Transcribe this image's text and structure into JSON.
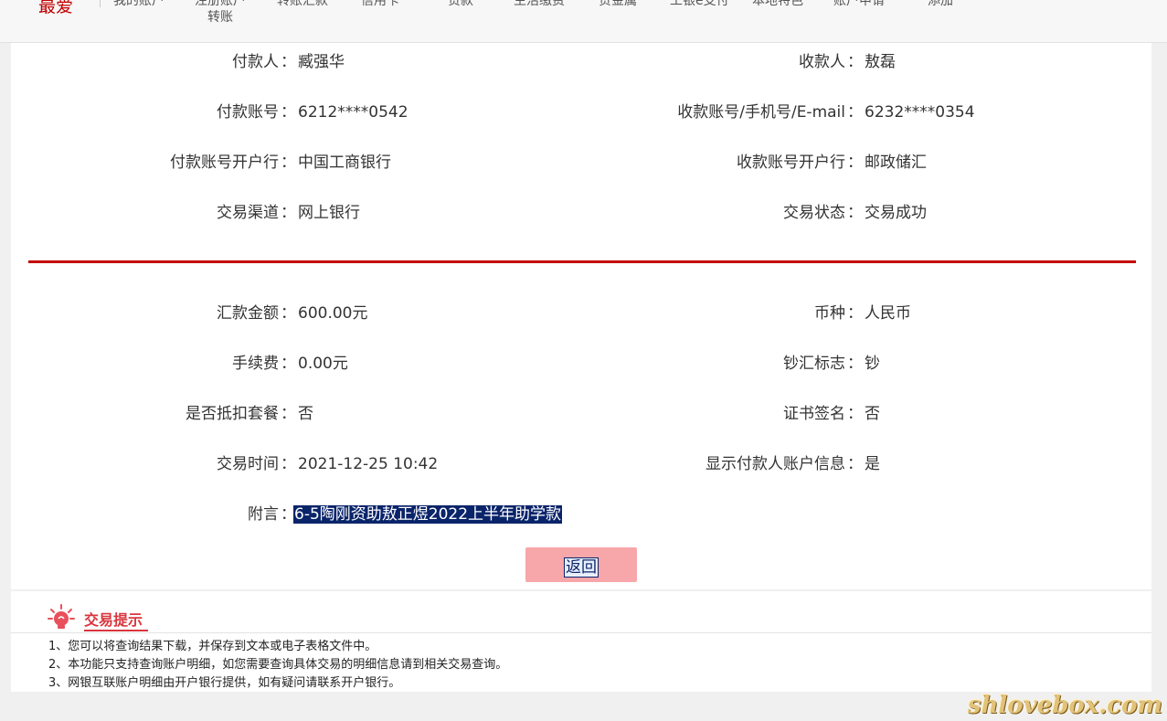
{
  "nav": {
    "brand": "最爱",
    "items": [
      {
        "label": "我的账户"
      },
      {
        "label": "注册账户\n转账"
      },
      {
        "label": "转账汇款"
      },
      {
        "label": "信用卡"
      },
      {
        "label": "贷款"
      },
      {
        "label": "生活缴费"
      },
      {
        "label": "贵金属"
      },
      {
        "label": "工银e支付"
      },
      {
        "label": "本地特色"
      },
      {
        "label": "账户申请"
      },
      {
        "label": "添加"
      }
    ]
  },
  "colon": "：",
  "parties": {
    "payer_label": "付款人",
    "payer_value": "臧强华",
    "payee_label": "收款人",
    "payee_value": "敖磊",
    "payer_acct_label": "付款账号",
    "payer_acct_value": "6212****0542",
    "payee_acct_label": "收款账号/手机号/E-mail",
    "payee_acct_value": "6232****0354",
    "payer_bank_label": "付款账号开户行",
    "payer_bank_value": "中国工商银行",
    "payee_bank_label": "收款账号开户行",
    "payee_bank_value": "邮政储汇",
    "channel_label": "交易渠道",
    "channel_value": "网上银行",
    "status_label": "交易状态",
    "status_value": "交易成功"
  },
  "details": {
    "amount_label": "汇款金额",
    "amount_value": "600.00元",
    "currency_label": "币种",
    "currency_value": "人民币",
    "fee_label": "手续费",
    "fee_value": "0.00元",
    "cash_flag_label": "钞汇标志",
    "cash_flag_value": "钞",
    "package_label": "是否抵扣套餐",
    "package_value": "否",
    "cert_label": "证书签名",
    "cert_value": "否",
    "time_label": "交易时间",
    "time_value": "2021-12-25 10:42",
    "show_payer_label": "显示付款人账户信息",
    "show_payer_value": "是",
    "memo_label": "附言",
    "memo_value": "6-5陶刚资助敖正煜2022上半年助学款"
  },
  "back_button": "返回",
  "tips": {
    "title": "交易提示",
    "items": [
      "1、您可以将查询结果下载，并保存到文本或电子表格文件中。",
      "2、本功能只支持查询账户明细，如您需要查询具体交易的明细信息请到相关交易查询。",
      "3、网银互联账户明细由开户银行提供，如有疑问请联系开户银行。"
    ]
  },
  "watermark": "shlovebox.com",
  "colors": {
    "brand_red": "#c40000",
    "button_bg": "#f7a7aa",
    "selection": "#0a246a"
  }
}
